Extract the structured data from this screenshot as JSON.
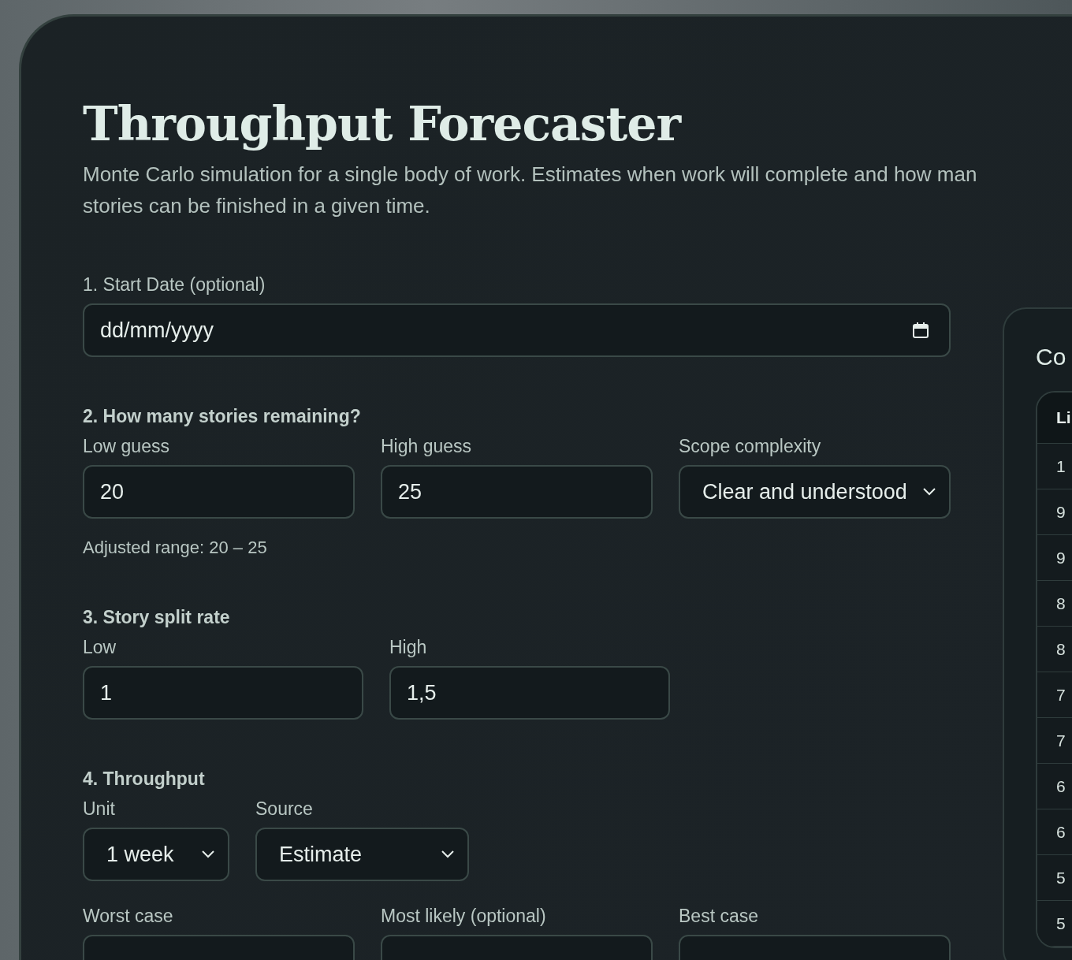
{
  "title": "Throughput Forecaster",
  "description": "Monte Carlo simulation for a single body of work. Estimates when work will complete and how man\nstories can be finished in a given time.",
  "start_date": {
    "label": "1. Start Date (optional)",
    "value": "dd/mm/yyyy"
  },
  "stories": {
    "heading": "2. How many stories remaining?",
    "fields": [
      {
        "label": "Low guess",
        "kind": "input",
        "value": "20"
      },
      {
        "label": "High guess",
        "kind": "input",
        "value": "25"
      },
      {
        "label": "Scope complexity",
        "kind": "select",
        "value": "Clear and understood"
      }
    ],
    "note": "Adjusted range: 20 – 25"
  },
  "split_rate": {
    "heading": "3. Story split rate",
    "fields": [
      {
        "label": "Low",
        "kind": "input",
        "value": "1"
      },
      {
        "label": "High",
        "kind": "input",
        "value": "1,5"
      }
    ]
  },
  "throughput": {
    "heading": "4. Throughput",
    "fields": [
      {
        "label": "Unit",
        "kind": "select",
        "value": "1 week"
      },
      {
        "label": "Source",
        "kind": "select",
        "value": "Estimate"
      }
    ],
    "estimates": [
      {
        "label": "Worst case"
      },
      {
        "label": "Most likely (optional)"
      },
      {
        "label": "Best case"
      }
    ]
  },
  "results_panel": {
    "title": "Co",
    "table": {
      "columns": [
        "Li"
      ],
      "rows": [
        "1",
        "9",
        "9",
        "8",
        "8",
        "7",
        "7",
        "6",
        "6",
        "5",
        "5"
      ]
    }
  }
}
